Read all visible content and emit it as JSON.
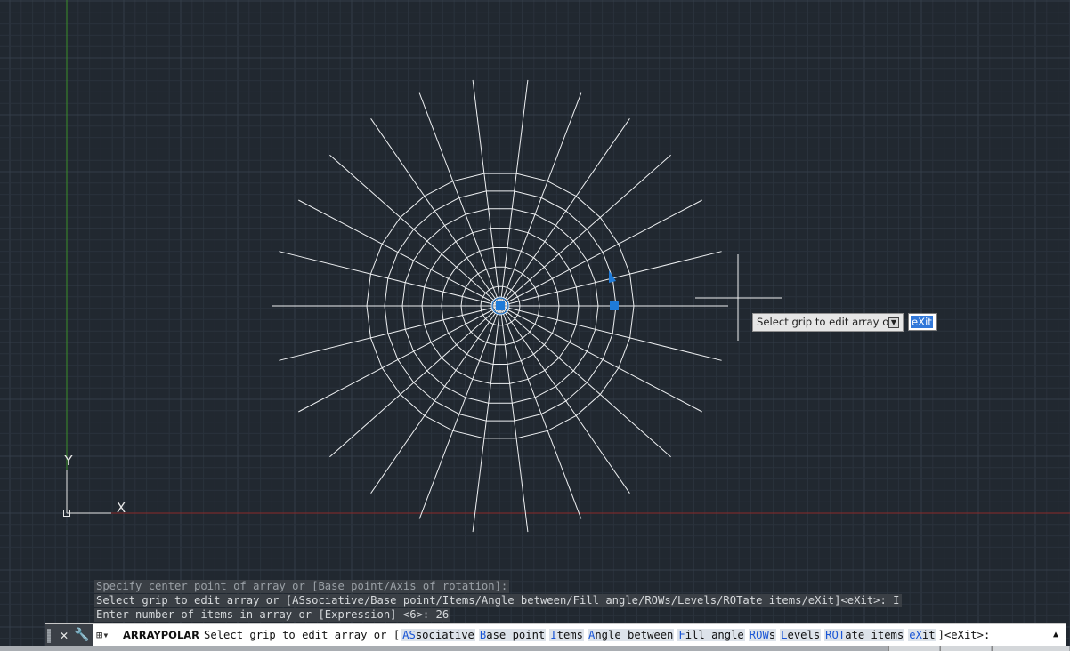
{
  "colors": {
    "background": "#212830",
    "grid_minor": "#2a323c",
    "grid_major": "#343d48",
    "geometry": "#eef0f2",
    "grip": "#1e7bd9",
    "y_axis": "#3a8f2a",
    "x_axis": "#8a2a2a"
  },
  "ucs": {
    "x_label": "X",
    "y_label": "Y"
  },
  "array": {
    "spokes": 26,
    "rings": 6
  },
  "history": [
    "Specify center point of array or [Base point/Axis of rotation]:",
    "Select grip to edit array or [ASsociative/Base point/Items/Angle between/Fill angle/ROWs/Levels/ROTate items/eXit]<eXit>: I",
    "Enter number of items in array or [Expression] <6>: 26"
  ],
  "dynamic_prompt": {
    "text": "Select grip to edit array or",
    "input_value": "eXit"
  },
  "command_line": {
    "close_icon": "close-icon",
    "customize_icon": "wrench-icon",
    "recent_icon": "recent-commands-icon",
    "command": "ARRAYPOLAR",
    "prompt_prefix": "Select grip to edit array or [",
    "options": [
      {
        "key": "AS",
        "rest": "sociative"
      },
      {
        "key": "B",
        "rest": "ase point"
      },
      {
        "key": "I",
        "rest": "tems"
      },
      {
        "key": "A",
        "rest": "ngle between"
      },
      {
        "key": "F",
        "rest": "ill angle"
      },
      {
        "key": "ROW",
        "rest": "s"
      },
      {
        "key": "L",
        "rest": "evels"
      },
      {
        "key": "ROT",
        "rest": "ate items"
      },
      {
        "key": "eX",
        "rest": "it"
      }
    ],
    "prompt_suffix": "]<eXit>:"
  }
}
